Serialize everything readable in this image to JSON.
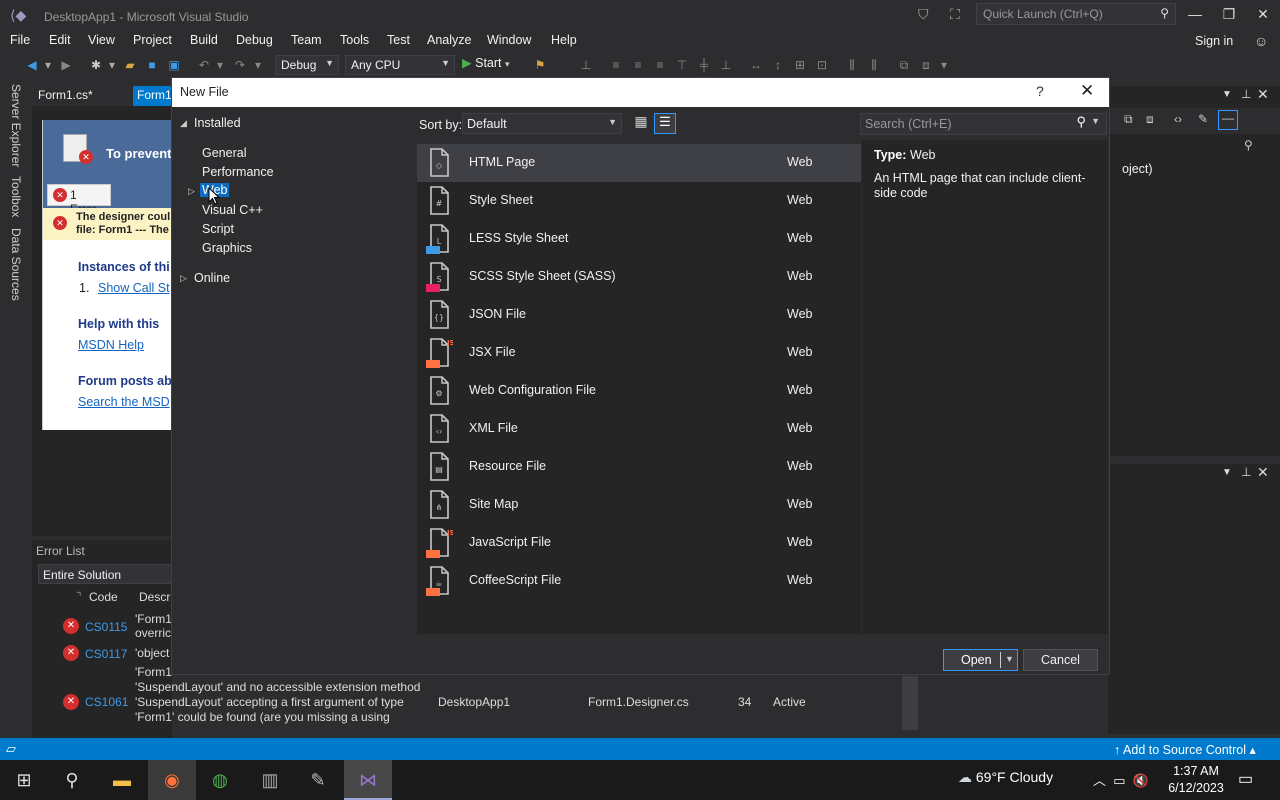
{
  "window": {
    "title": "DesktopApp1 - Microsoft Visual Studio",
    "quick_launch_placeholder": "Quick Launch (Ctrl+Q)",
    "sign_in": "Sign in"
  },
  "menu": [
    "File",
    "Edit",
    "View",
    "Project",
    "Build",
    "Debug",
    "Team",
    "Tools",
    "Test",
    "Analyze",
    "Window",
    "Help"
  ],
  "toolbar": {
    "config": "Debug",
    "platform": "Any CPU",
    "start": "Start"
  },
  "side_tabs": [
    "Server Explorer",
    "Toolbox",
    "Data Sources"
  ],
  "doc_tabs": [
    "Form1.cs*",
    "Form1"
  ],
  "designer": {
    "heading": "To prevent",
    "error_badge": "1 Error",
    "banner_line1": "The designer coul",
    "banner_line2": "file: Form1 --- The",
    "instances_heading": "Instances of thi",
    "num1": "1.",
    "show_call_stack": "Show Call St",
    "help_heading": "Help with this",
    "msdn_help": "MSDN Help",
    "forum_heading": "Forum posts ab",
    "search_msdn": "Search the MSD"
  },
  "error_list": {
    "title": "Error List",
    "scope": "Entire Solution",
    "col_code": "Code",
    "col_desc": "Descri",
    "rows": [
      {
        "code": "CS0115",
        "desc1": "'Form1",
        "desc2": "overric"
      },
      {
        "code": "CS0117",
        "desc1": "'object"
      },
      {
        "code": "CS1061",
        "desc1": "'Form1",
        "desc2": "'SuspendLayout' and no accessible extension method",
        "desc3": "'SuspendLayout' accepting a first argument of type",
        "desc4": "'Form1' could be found (are you missing a using",
        "project": "DesktopApp1",
        "file": "Form1.Designer.cs",
        "line": "34",
        "suppression": "Active"
      }
    ]
  },
  "dialog": {
    "title": "New File",
    "help": "?",
    "tree": {
      "installed": "Installed",
      "items": [
        "General",
        "Performance",
        "Web",
        "Visual C++",
        "Script",
        "Graphics"
      ],
      "online": "Online"
    },
    "sort_label": "Sort by:",
    "sort_value": "Default",
    "search_placeholder": "Search (Ctrl+E)",
    "templates": [
      {
        "name": "HTML Page",
        "category": "Web",
        "icon": "html-page-icon"
      },
      {
        "name": "Style Sheet",
        "category": "Web",
        "icon": "style-sheet-icon"
      },
      {
        "name": "LESS Style Sheet",
        "category": "Web",
        "icon": "less-icon"
      },
      {
        "name": "SCSS Style Sheet (SASS)",
        "category": "Web",
        "icon": "scss-icon"
      },
      {
        "name": "JSON File",
        "category": "Web",
        "icon": "json-icon"
      },
      {
        "name": "JSX File",
        "category": "Web",
        "icon": "jsx-icon"
      },
      {
        "name": "Web Configuration File",
        "category": "Web",
        "icon": "web-config-icon"
      },
      {
        "name": "XML File",
        "category": "Web",
        "icon": "xml-icon"
      },
      {
        "name": "Resource File",
        "category": "Web",
        "icon": "resource-icon"
      },
      {
        "name": "Site Map",
        "category": "Web",
        "icon": "sitemap-icon"
      },
      {
        "name": "JavaScript File",
        "category": "Web",
        "icon": "javascript-icon"
      },
      {
        "name": "CoffeeScript File",
        "category": "Web",
        "icon": "coffeescript-icon"
      }
    ],
    "details": {
      "type_label": "Type:",
      "type_value": "Web",
      "description": "An HTML page that can include client-side code"
    },
    "open": "Open",
    "cancel": "Cancel"
  },
  "right_panel": {
    "fragment": "oject)"
  },
  "status": {
    "source_control": "Add to Source Control"
  },
  "taskbar": {
    "weather": "69°F  Cloudy",
    "time": "1:37 AM",
    "date": "6/12/2023"
  },
  "colors": {
    "accent": "#007acc",
    "selection": "#0e6cc0",
    "error": "#d32f2f"
  }
}
